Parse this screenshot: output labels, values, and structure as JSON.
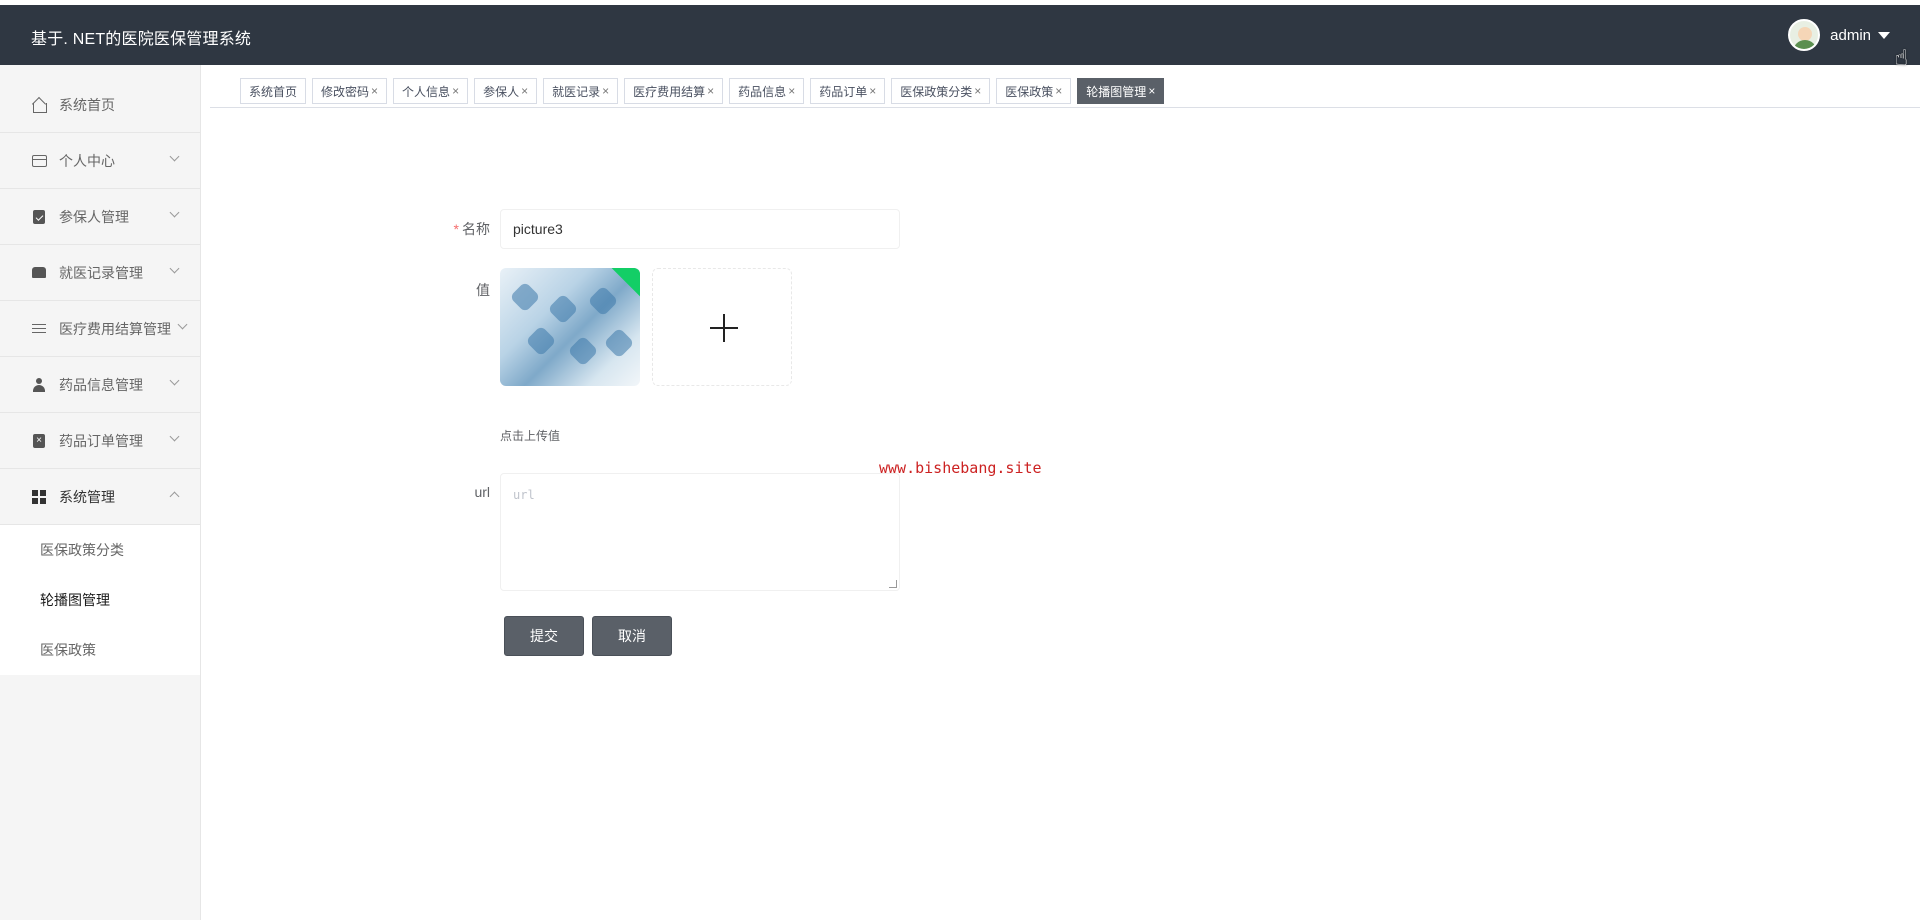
{
  "header": {
    "title": "基于. NET的医院医保管理系统",
    "user_name": "admin"
  },
  "sidebar": {
    "items": [
      {
        "label": "系统首页",
        "icon": "home-icon"
      },
      {
        "label": "个人中心",
        "icon": "card-icon"
      },
      {
        "label": "参保人管理",
        "icon": "clipboard-check-icon"
      },
      {
        "label": "就医记录管理",
        "icon": "box-icon"
      },
      {
        "label": "医疗费用结算管理",
        "icon": "sliders-icon"
      },
      {
        "label": "药品信息管理",
        "icon": "person-icon"
      },
      {
        "label": "药品订单管理",
        "icon": "clipboard-x-icon"
      },
      {
        "label": "系统管理",
        "icon": "grid-icon"
      }
    ],
    "subitems": [
      {
        "label": "医保政策分类"
      },
      {
        "label": "轮播图管理"
      },
      {
        "label": "医保政策"
      }
    ]
  },
  "tabs": [
    {
      "label": "系统首页",
      "closable": false
    },
    {
      "label": "修改密码",
      "closable": true
    },
    {
      "label": "个人信息",
      "closable": true
    },
    {
      "label": "参保人",
      "closable": true
    },
    {
      "label": "就医记录",
      "closable": true
    },
    {
      "label": "医疗费用结算",
      "closable": true
    },
    {
      "label": "药品信息",
      "closable": true
    },
    {
      "label": "药品订单",
      "closable": true
    },
    {
      "label": "医保政策分类",
      "closable": true
    },
    {
      "label": "医保政策",
      "closable": true
    },
    {
      "label": "轮播图管理",
      "closable": true,
      "active": true
    }
  ],
  "tab_close_glyph": "×",
  "form": {
    "name_label": "名称",
    "required_mark": "*",
    "name_value": "picture3",
    "value_label": "值",
    "upload_tip": "点击上传值",
    "url_label": "url",
    "url_placeholder": "url",
    "submit_label": "提交",
    "cancel_label": "取消"
  },
  "watermark": "www.bishebang.site",
  "colors": {
    "header_bg": "#2f3742",
    "button_bg": "#5a6068",
    "success": "#13ce66",
    "required": "#f56c6c"
  }
}
